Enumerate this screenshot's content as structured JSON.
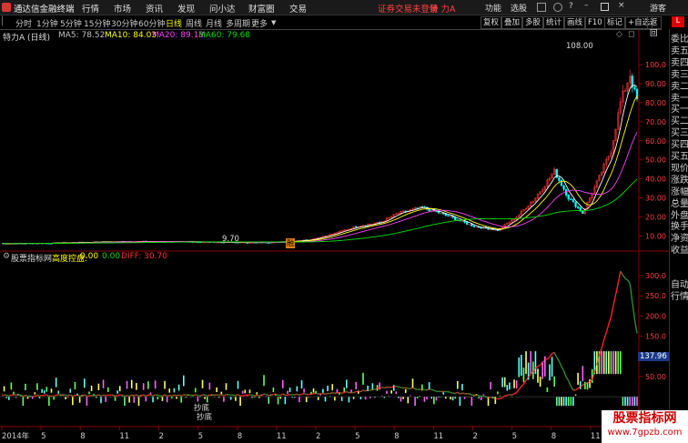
{
  "app": {
    "title": "通达信金融终端",
    "stock_banner": "证券交易未登录",
    "stock_name": "特 力A",
    "guest": "游客"
  },
  "menu": [
    "行情",
    "市场",
    "资讯",
    "发现",
    "问小达",
    "财富圈",
    "交易"
  ],
  "top_right": [
    "功能",
    "选股"
  ],
  "periods": [
    "分时",
    "1分钟",
    "5分钟",
    "15分钟",
    "30分钟",
    "60分钟",
    "日线",
    "周线",
    "月线",
    "多周期",
    "更多"
  ],
  "active_period": "日线",
  "toolbar_right": [
    "复权",
    "叠加",
    "多股",
    "统计",
    "画线",
    "F10",
    "标记",
    "+自选",
    "返回"
  ],
  "main_chart": {
    "label": "特力A (日线)",
    "ma": [
      {
        "name": "MA5: 78.52",
        "color": "#ffffff"
      },
      {
        "name": "MA10: 84.03",
        "color": "#ffff00"
      },
      {
        "name": "MA20: 89.13",
        "color": "#ff40ff"
      },
      {
        "name": "MA60: 79.68",
        "color": "#00e000"
      }
    ],
    "price_axis": [
      "100.0",
      "90.00",
      "80.00",
      "70.00",
      "60.00",
      "50.00",
      "40.00",
      "30.00",
      "20.00",
      "10.00"
    ],
    "high_label": "108.00",
    "low_label": "9.70",
    "event_marker": "融"
  },
  "indicator": {
    "site": "股票指标网",
    "name": "高度控盘:",
    "v1": "0.00",
    "v2": "0.00",
    "diff": "DIFF: 30.70",
    "axis": [
      "300.0",
      "250.0",
      "200.0",
      "150.0",
      "100.0",
      "50.00"
    ],
    "current_value": "137.96",
    "annot1": "抄底",
    "annot2": "抄底"
  },
  "right_panel": [
    "委比",
    "卖五",
    "卖四",
    "卖三",
    "卖二",
    "卖一",
    "买一",
    "买二",
    "买三",
    "买四",
    "买五",
    "现价",
    "涨跌",
    "涨幅",
    "总量",
    "外盘",
    "换手",
    "净资",
    "收益"
  ],
  "right_panel_bottom": [
    "自动",
    "行情"
  ],
  "date_axis": [
    "2014年",
    "5",
    "8",
    "11",
    "2",
    "5",
    "8",
    "11",
    "2",
    "5",
    "8",
    "11",
    "2",
    "5",
    "8",
    "11",
    "12"
  ],
  "watermark": {
    "line1": "股票指标网",
    "line2": "www.7gpzb.com"
  },
  "colors": {
    "up": "#ff3030",
    "down": "#00ffff",
    "ma5": "#ffffff",
    "ma10": "#ffff00",
    "ma20": "#ff40ff",
    "ma60": "#00e000"
  }
}
